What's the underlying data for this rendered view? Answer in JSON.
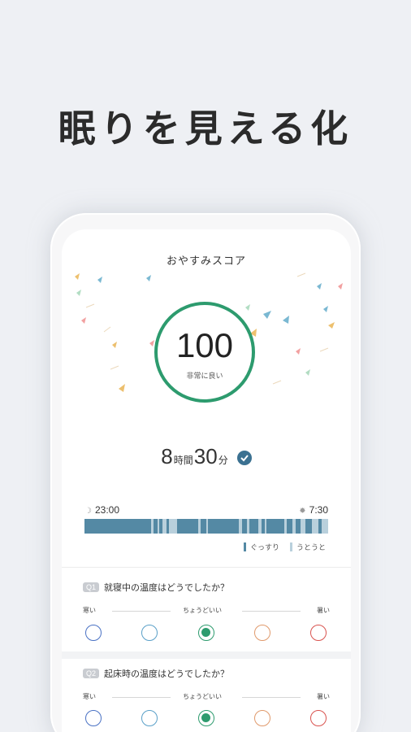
{
  "headline": "眠りを見える化",
  "score_card": {
    "title": "おやすみスコア",
    "score": "100",
    "score_label": "非常に良い",
    "ring_color": "#2d9b6e"
  },
  "duration": {
    "hours": "8",
    "hours_unit": "時間",
    "minutes": "30",
    "minutes_unit": "分",
    "check_icon": "check-circle-icon"
  },
  "timeline": {
    "start_icon": "moon-icon",
    "start": "23:00",
    "end_icon": "sun-icon",
    "end": "7:30",
    "deep_color": "#5489a4",
    "light_color": "#b9d0dc",
    "legend": [
      {
        "label": "ぐっすり",
        "color": "#5489a4"
      },
      {
        "label": "うとうと",
        "color": "#b9d0dc"
      }
    ]
  },
  "questions": [
    {
      "badge": "Q1",
      "text": "就寝中の温度はどうでしたか？",
      "scale_left": "寒い",
      "scale_mid": "ちょうどいい",
      "scale_right": "暑い",
      "selected_index": 2
    },
    {
      "badge": "Q2",
      "text": "起床時の温度はどうでしたか？",
      "scale_left": "寒い",
      "scale_mid": "ちょうどいい",
      "scale_right": "暑い",
      "selected_index": 2
    }
  ],
  "option_colors": [
    "#4a72c4",
    "#5aa0c8",
    "#2d9b6e",
    "#e09a6c",
    "#d9534f"
  ]
}
